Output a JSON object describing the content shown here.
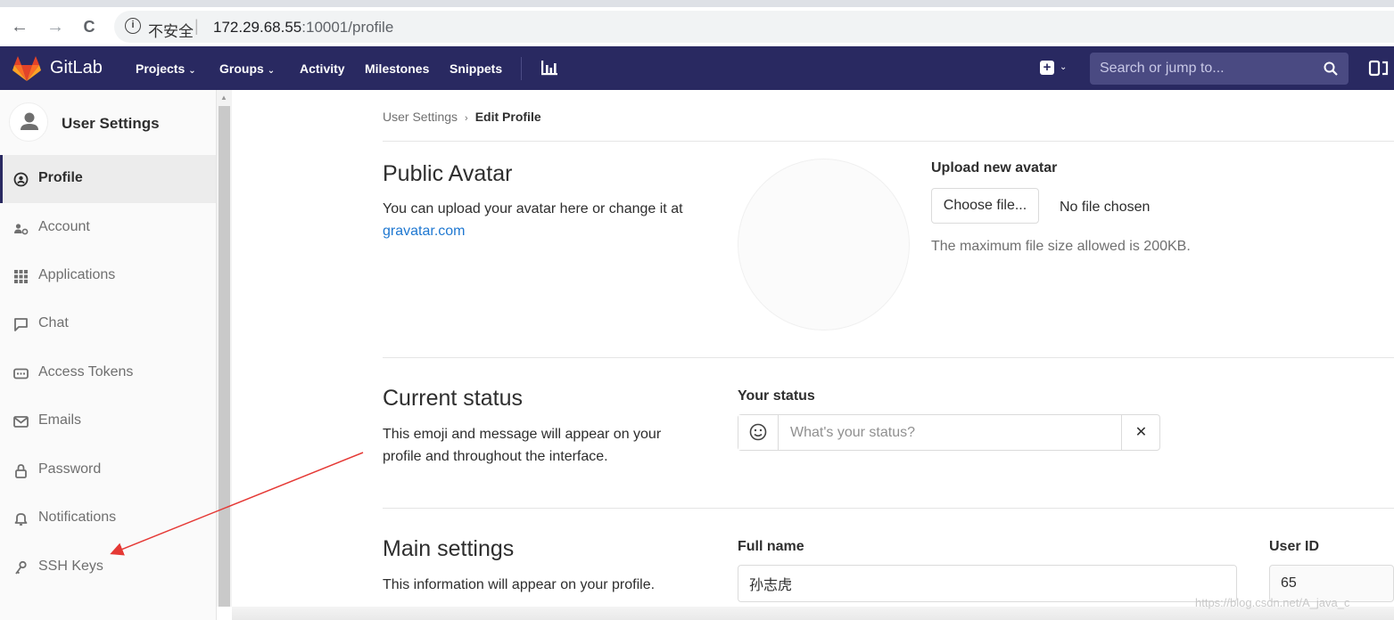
{
  "browser": {
    "back": "←",
    "forward": "→",
    "reload": "C",
    "info": "i",
    "insecure": "不安全",
    "sep": "|",
    "url_host": "172.29.68.55",
    "url_rest": ":10001/profile"
  },
  "header": {
    "brand": "GitLab",
    "nav": [
      "Projects",
      "Groups",
      "Activity",
      "Milestones",
      "Snippets"
    ],
    "search_placeholder": "Search or jump to..."
  },
  "sidebar": {
    "title": "User Settings",
    "items": [
      {
        "label": "Profile",
        "icon": "profile-icon",
        "active": true
      },
      {
        "label": "Account",
        "icon": "account-icon"
      },
      {
        "label": "Applications",
        "icon": "applications-icon"
      },
      {
        "label": "Chat",
        "icon": "chat-icon"
      },
      {
        "label": "Access Tokens",
        "icon": "token-icon"
      },
      {
        "label": "Emails",
        "icon": "email-icon"
      },
      {
        "label": "Password",
        "icon": "lock-icon"
      },
      {
        "label": "Notifications",
        "icon": "bell-icon"
      },
      {
        "label": "SSH Keys",
        "icon": "key-icon"
      }
    ]
  },
  "breadcrumb": {
    "parent": "User Settings",
    "sep": "›",
    "current": "Edit Profile"
  },
  "avatar": {
    "title": "Public Avatar",
    "desc": "You can upload your avatar here or change it at",
    "link": "gravatar.com",
    "upload_label": "Upload new avatar",
    "choose_button": "Choose file...",
    "no_file": "No file chosen",
    "help": "The maximum file size allowed is 200KB."
  },
  "status": {
    "title": "Current status",
    "desc_line1": "This emoji and message will appear on your",
    "desc_line2": "profile and throughout the interface.",
    "label": "Your status",
    "placeholder": "What's your status?",
    "clear": "✕"
  },
  "main_settings": {
    "title": "Main settings",
    "desc": "This information will appear on your profile.",
    "full_name_label": "Full name",
    "full_name_value": "孙志虎",
    "user_id_label": "User ID",
    "user_id_value": "65"
  },
  "watermark": "https://blog.csdn.net/A_java_c",
  "colors": {
    "header_bg": "#292961",
    "link": "#1f78d1",
    "annotation_arrow": "#e53935"
  }
}
